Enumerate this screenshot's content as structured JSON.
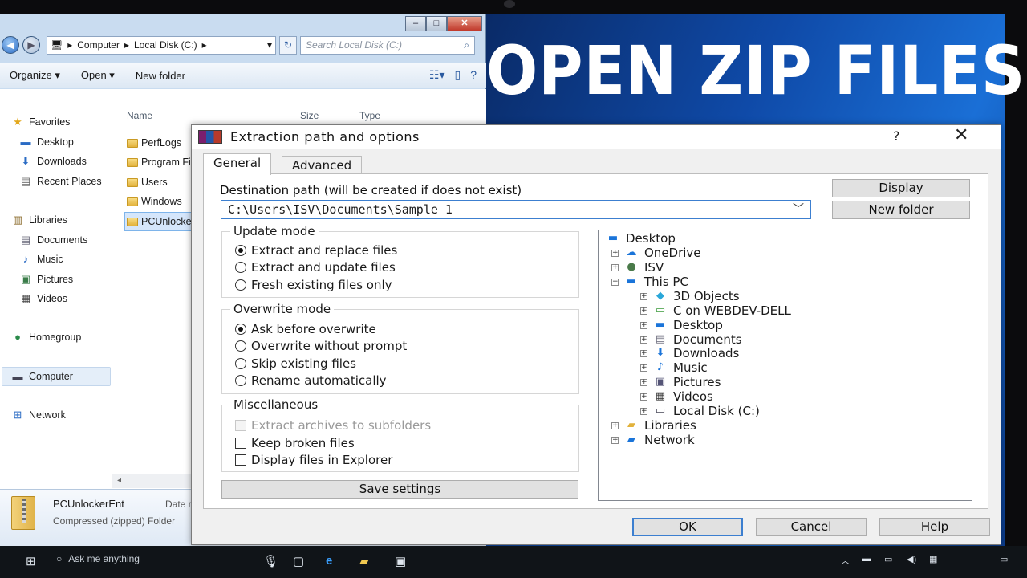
{
  "banner": {
    "text": "OPEN ZIP FILES"
  },
  "explorer": {
    "address": {
      "computer": "Computer",
      "disk": "Local Disk (C:)"
    },
    "search_placeholder": "Search Local Disk (C:)",
    "toolbar": {
      "organize": "Organize ▾",
      "open": "Open ▾",
      "new_folder": "New folder"
    },
    "nav": {
      "favorites": "Favorites",
      "desktop": "Desktop",
      "downloads": "Downloads",
      "recent_places": "Recent Places",
      "libraries": "Libraries",
      "documents": "Documents",
      "music": "Music",
      "pictures": "Pictures",
      "videos": "Videos",
      "homegroup": "Homegroup",
      "computer": "Computer",
      "network": "Network"
    },
    "columns": {
      "name": "Name",
      "size": "Size",
      "type": "Type"
    },
    "files": [
      "PerfLogs",
      "Program File",
      "Users",
      "Windows",
      "PCUnlockerE"
    ],
    "details": {
      "name": "PCUnlockerEnt",
      "type": "Compressed (zipped) Folder",
      "date_label": "Date m"
    }
  },
  "dialog": {
    "title": "Extraction path and options",
    "help_glyph": "?",
    "tabs": {
      "general": "General",
      "advanced": "Advanced"
    },
    "destination_label": "Destination path (will be created if does not exist)",
    "destination_value": "C:\\Users\\ISV\\Documents\\Sample 1",
    "display_button": "Display",
    "new_folder_button": "New folder",
    "update_mode": {
      "title": "Update mode",
      "options": [
        "Extract and replace files",
        "Extract and update files",
        "Fresh existing files only"
      ],
      "selected": 0
    },
    "overwrite_mode": {
      "title": "Overwrite mode",
      "options": [
        "Ask before overwrite",
        "Overwrite without prompt",
        "Skip existing files",
        "Rename automatically"
      ],
      "selected": 0
    },
    "misc": {
      "title": "Miscellaneous",
      "extract_subfolders": "Extract archives to subfolders",
      "keep_broken": "Keep broken files",
      "display_explorer": "Display files in Explorer"
    },
    "save_settings": "Save settings",
    "tree": {
      "desktop": "Desktop",
      "onedrive": "OneDrive",
      "isv": "ISV",
      "this_pc": "This PC",
      "objects3d": "3D Objects",
      "c_on": "C on WEBDEV-DELL",
      "pc_desktop": "Desktop",
      "documents": "Documents",
      "downloads": "Downloads",
      "music": "Music",
      "pictures": "Pictures",
      "videos": "Videos",
      "local_disk": "Local Disk (C:)",
      "libraries": "Libraries",
      "network": "Network"
    },
    "ok": "OK",
    "cancel": "Cancel",
    "help": "Help"
  },
  "taskbar": {
    "search": "Ask me anything"
  }
}
